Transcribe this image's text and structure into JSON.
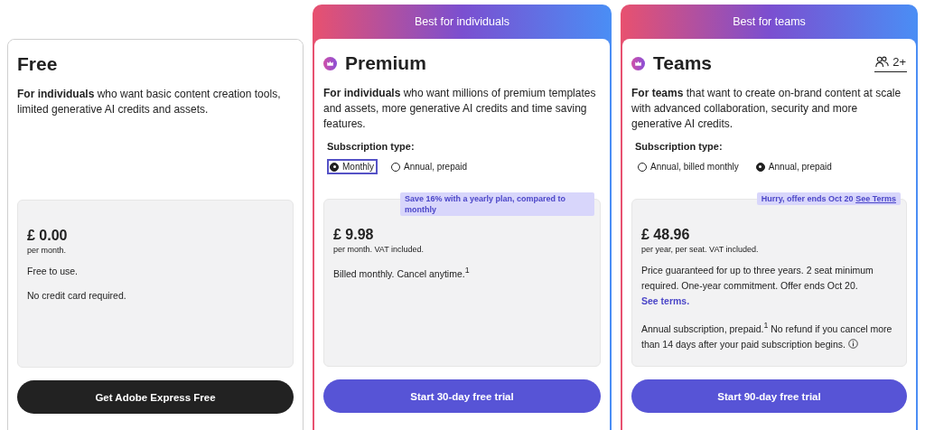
{
  "plans": [
    {
      "kind": "free",
      "title": "Free",
      "description": "**For individuals** who want basic content creation tools, limited generative AI credits and assets.",
      "price": "£ 0.00",
      "price_note": "per month.",
      "notes": [
        {
          "text": "Free to use.",
          "info": false
        },
        {
          "text": "No credit card required.",
          "info": false
        }
      ],
      "button": {
        "label": "Get Adobe Express Free"
      }
    },
    {
      "kind": "premium",
      "banner": "Best for individuals",
      "title": "Premium",
      "description": "**For individuals** who want millions of premium templates and assets, more generative AI credits and time saving features.",
      "subscription": {
        "label": "Subscription type:",
        "options": [
          {
            "label": "Monthly",
            "selected": true,
            "focused": true
          },
          {
            "label": "Annual, prepaid",
            "selected": false,
            "focused": false
          }
        ]
      },
      "promo": {
        "text": "Save 16% with a yearly plan, compared to monthly"
      },
      "price": "£ 9.98",
      "price_note": "per month. VAT included.",
      "notes": [
        {
          "text": "Billed monthly. Cancel anytime.$^{1}$",
          "info": false
        }
      ],
      "button": {
        "label": "Start 30-day free trial"
      }
    },
    {
      "kind": "teams",
      "banner": "Best for teams",
      "title": "Teams",
      "seats": "2+",
      "description": "**For teams** that want to create on-brand content at scale with advanced collaboration, security and more generative AI credits.",
      "subscription": {
        "label": "Subscription type:",
        "options": [
          {
            "label": "Annual, billed monthly",
            "selected": false,
            "focused": false
          },
          {
            "label": "Annual, prepaid",
            "selected": true,
            "focused": false
          }
        ]
      },
      "promo": {
        "text": "Hurry, offer ends Oct 20",
        "link": "See Terms"
      },
      "price": "£ 48.96",
      "price_note": "per year, per seat. VAT included.",
      "notes": [
        {
          "text": "Price guaranteed for up to three years. 2 seat minimum required. One-year commitment. Offer ends Oct 20.",
          "link": "See terms.",
          "info": false
        },
        {
          "text": "Annual subscription, prepaid.$^{1}$ No refund if you cancel more than 14 days after your paid subscription begins.",
          "info": true
        }
      ],
      "button": {
        "label": "Start 90-day free trial"
      }
    }
  ]
}
